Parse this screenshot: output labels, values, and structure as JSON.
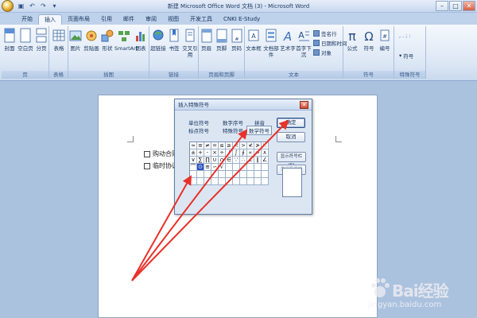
{
  "window": {
    "title": "新建 Microsoft Office Word 文档 (3) - Microsoft Word",
    "minimize": "–",
    "maximize": "□",
    "close": "✕"
  },
  "tabs": [
    {
      "label": "开始"
    },
    {
      "label": "插入"
    },
    {
      "label": "页面布局"
    },
    {
      "label": "引用"
    },
    {
      "label": "邮件"
    },
    {
      "label": "审阅"
    },
    {
      "label": "视图"
    },
    {
      "label": "开发工具"
    },
    {
      "label": "CNKI E-Study"
    }
  ],
  "ribbon": {
    "groups": {
      "page": "页",
      "table": "表格",
      "illustrations": "插图",
      "links": "链接",
      "header_footer": "页眉和页脚",
      "text": "文本",
      "symbols": "符号",
      "special_symbols": "特殊符号"
    },
    "buttons": {
      "cover": "封面",
      "blank_page": "空白页",
      "page_break": "分页",
      "table": "表格",
      "picture": "图片",
      "clipart": "剪贴画",
      "shapes": "形状",
      "smartart": "SmartArt",
      "chart": "图表",
      "hyperlink": "超链接",
      "bookmark": "书签",
      "cross_ref": "交叉引用",
      "header": "页眉",
      "footer": "页脚",
      "page_number": "页码",
      "textbox": "文本框",
      "doc_parts": "文档部件",
      "wordart": "艺术字",
      "dropcap": "首字下沉",
      "signature_line": "签名行",
      "datetime": "日期和时间",
      "object": "对象",
      "formula": "公式",
      "symbol": "符号",
      "numbering": "编号",
      "special_symbol": "符号"
    }
  },
  "document": {
    "lines": [
      "购动合同",
      "临时协议"
    ]
  },
  "dialog": {
    "title": "插入特殊符号",
    "categories": [
      "单位符号",
      "数字序号",
      "拼音",
      "标点符号",
      "特殊符号",
      "数学符号"
    ],
    "selected_category": "数学符号",
    "buttons": {
      "ok": "确定",
      "cancel": "取消",
      "show_bar": "显示符号栏(S)",
      "reset_bar": "重设符号栏(R)"
    },
    "symbols": [
      "≈",
      "≡",
      "≠",
      "=",
      "≤",
      "≥",
      "<",
      ">",
      "≮",
      "≯",
      "∷",
      "±",
      "+",
      "-",
      "×",
      "÷",
      "/",
      "∫",
      "∮",
      "∝",
      "∞",
      "∧",
      "∨",
      "∑",
      "∏",
      "∪",
      "∩",
      "∈",
      "∵",
      "∴",
      "⊥",
      "∥",
      "∠",
      "⌒",
      "⊙",
      "≌",
      "∽",
      "√",
      "",
      "",
      "",
      "",
      "",
      "",
      "",
      "",
      "",
      "",
      "",
      "",
      "",
      "",
      "",
      "",
      "",
      "",
      "",
      "",
      "",
      "",
      "",
      "",
      "",
      "",
      "",
      ""
    ],
    "selected_symbol_index": 34
  },
  "watermark": {
    "brand": "Bai经验",
    "url": "jingyan.baidu.com"
  }
}
